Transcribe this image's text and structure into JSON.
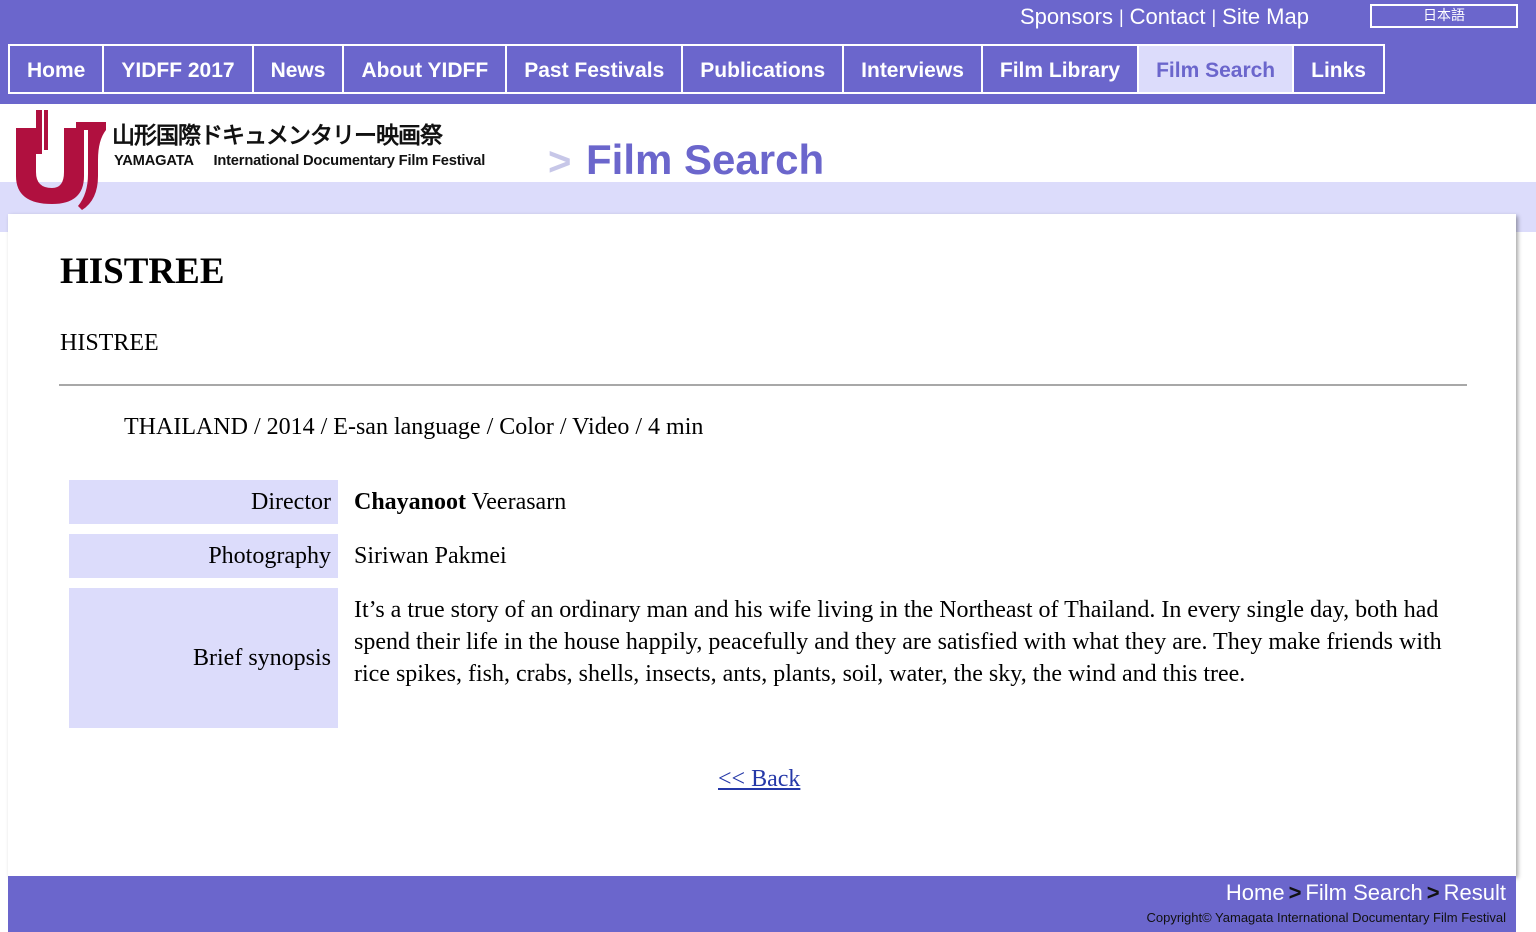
{
  "header": {
    "utility_links": [
      "Sponsors",
      "Contact",
      "Site Map"
    ],
    "language_button": "日本語",
    "nav": [
      {
        "label": "Home",
        "active": false
      },
      {
        "label": "YIDFF 2017",
        "active": false
      },
      {
        "label": "News",
        "active": false
      },
      {
        "label": "About YIDFF",
        "active": false
      },
      {
        "label": "Past Festivals",
        "active": false
      },
      {
        "label": "Publications",
        "active": false
      },
      {
        "label": "Interviews",
        "active": false
      },
      {
        "label": "Film Library",
        "active": false
      },
      {
        "label": "Film Search",
        "active": true
      },
      {
        "label": "Links",
        "active": false
      }
    ],
    "logo_jp": "山形国際ドキュメンタリー映画祭",
    "logo_en_1": "YAMAGATA",
    "logo_en_2": "International Documentary Film Festival",
    "breadcrumb_arrow": ">",
    "page_heading": "Film Search"
  },
  "film": {
    "title": "HISTREE",
    "original_title": "HISTREE",
    "meta": "THAILAND / 2014 / E-san language / Color / Video / 4 min",
    "credits": [
      {
        "label": "Director",
        "value_bold": "Chayanoot",
        "value": " Veerasarn"
      },
      {
        "label": "Photography",
        "value_bold": "",
        "value": "Siriwan Pakmei"
      },
      {
        "label": "Brief synopsis",
        "value_bold": "",
        "value": "It’s a true story of an ordinary man and his wife living in the Northeast of Thailand. In every single day, both had spend their life in the house happily, peacefully and they are satisfied with what they are. They make friends with rice spikes, fish, crabs, shells, insects, ants, plants, soil, water, the sky, the wind and this tree."
      }
    ],
    "back_link": "<< Back"
  },
  "footer": {
    "breadcrumb": [
      "Home",
      "Film Search",
      "Result"
    ],
    "separator": ">",
    "copyright": "Copyright© Yamagata International Documentary Film Festival"
  },
  "colors": {
    "brand_purple": "#6b66cc",
    "light_lavender": "#dcdcfb",
    "logo_red": "#b0103f",
    "link_blue": "#2538a8"
  }
}
